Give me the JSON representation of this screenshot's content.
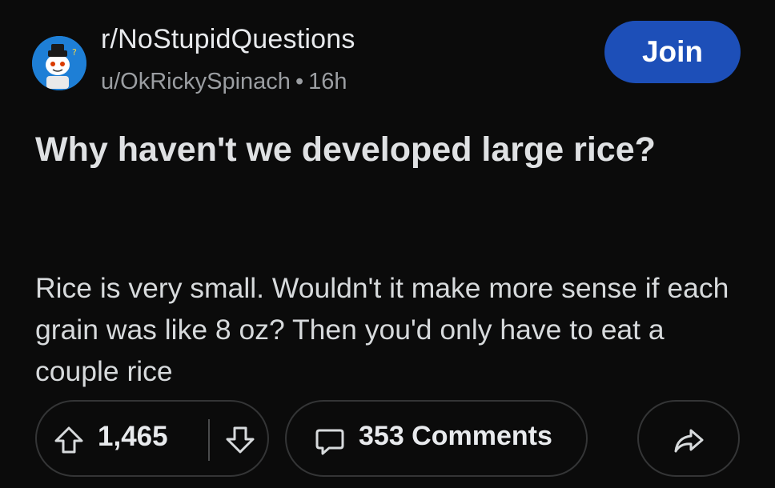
{
  "header": {
    "subreddit": "r/NoStupidQuestions",
    "author": "u/OkRickySpinach",
    "separator": "•",
    "age": "16h",
    "join_label": "Join"
  },
  "post": {
    "title": "Why haven't we developed large rice?",
    "body": "Rice is very small. Wouldn't it make more sense if each grain was like 8 oz? Then you'd only have to eat a couple rice"
  },
  "actions": {
    "vote_count": "1,465",
    "comments_label": "353 Comments"
  },
  "icons": {
    "avatar": "subreddit-avatar-icon",
    "upvote": "upvote-arrow-icon",
    "downvote": "downvote-arrow-icon",
    "comment": "comment-bubble-icon",
    "share": "share-arrow-icon"
  },
  "colors": {
    "background": "#0b0b0b",
    "join_button": "#1d4fb8",
    "avatar_bg": "#1e7fd6",
    "pill_border": "#343536",
    "meta_text": "#9b9ea2"
  }
}
